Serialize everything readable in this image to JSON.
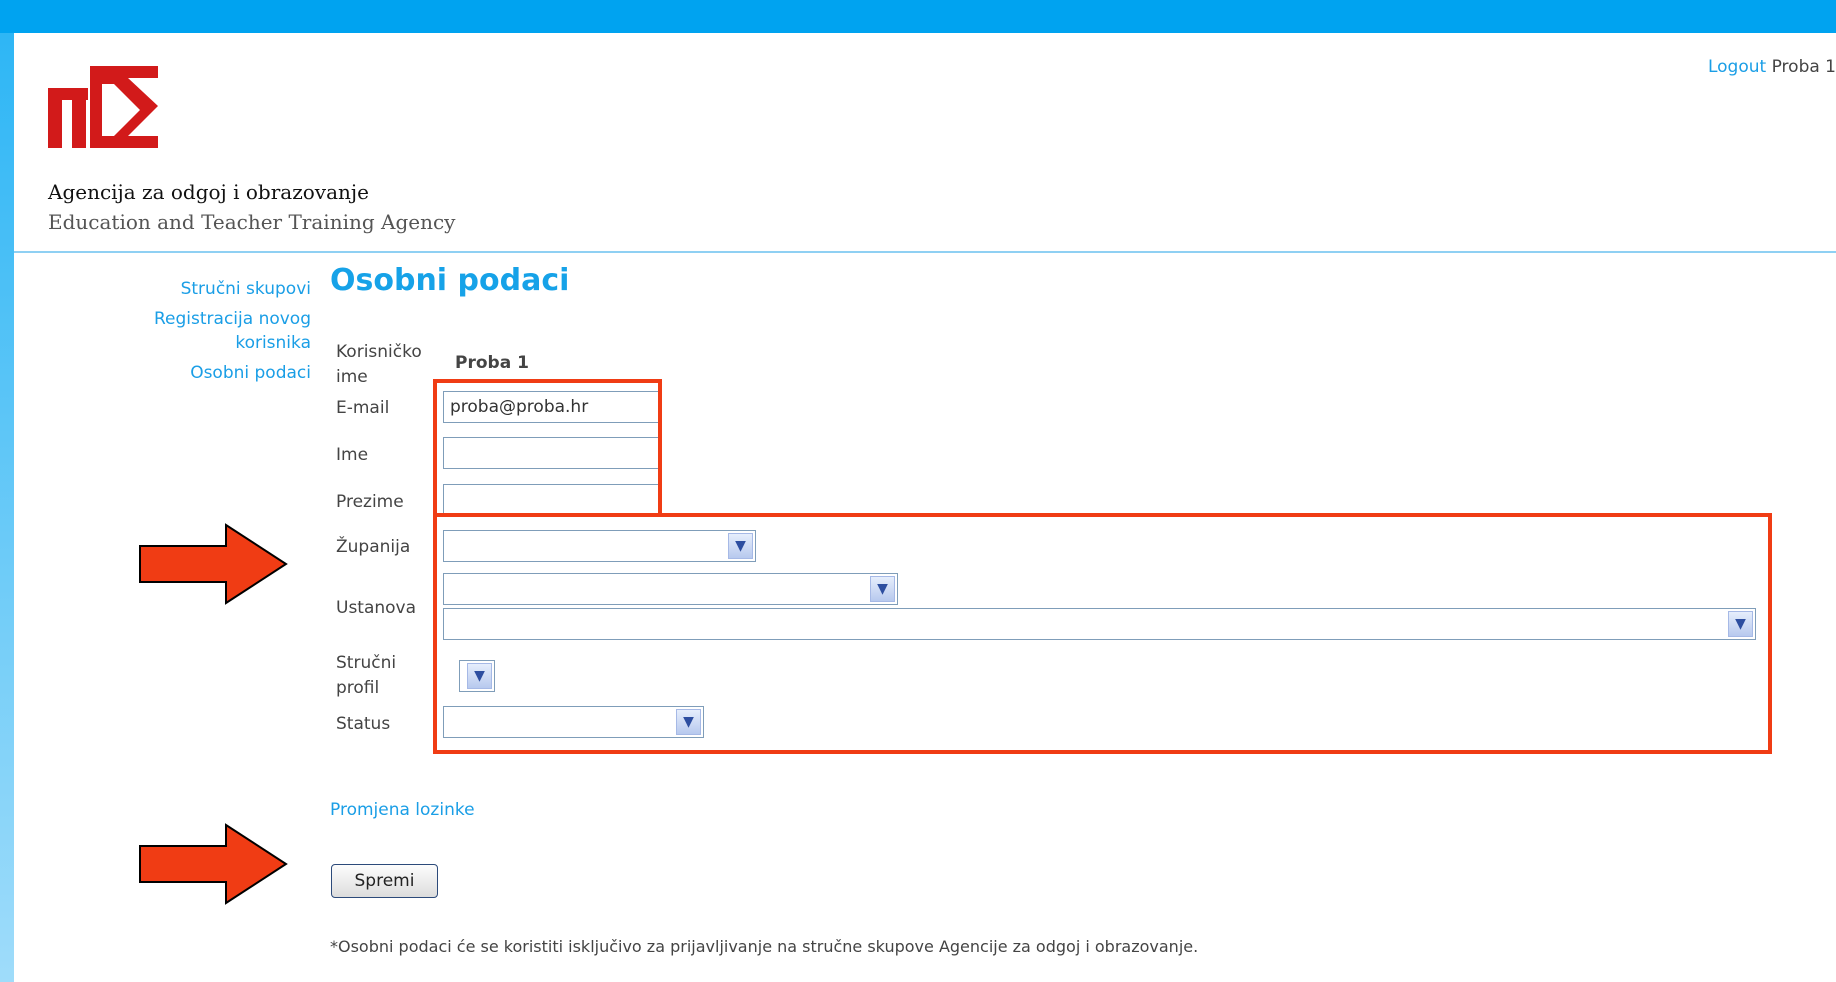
{
  "header": {
    "logout_label": "Logout",
    "user_name": "Proba 1",
    "agency_name_hr": "Agencija za odgoj i obrazovanje",
    "agency_name_en": "Education and Teacher Training Agency"
  },
  "sidebar": {
    "items": [
      {
        "label": "Stručni skupovi"
      },
      {
        "label": "Registracija novog korisnika"
      },
      {
        "label": "Osobni podaci"
      }
    ]
  },
  "page": {
    "title": "Osobni podaci",
    "fields": {
      "username_label": "Korisničko ime",
      "username_value": "Proba 1",
      "email_label": "E-mail",
      "email_value": "proba@proba.hr",
      "ime_label": "Ime",
      "ime_value": "",
      "prezime_label": "Prezime",
      "prezime_value": "",
      "zupanija_label": "Županija",
      "ustanova_label": "Ustanova",
      "strucni_profil_label": "Stručni profil",
      "status_label": "Status"
    },
    "change_password_link": "Promjena lozinke",
    "save_button": "Spremi",
    "footnote": "*Osobni podaci će se koristiti isključivo za prijavljivanje na stručne skupove Agencije za odgoj i obrazovanje."
  },
  "colors": {
    "accent": "#00a3f0",
    "link": "#1a9ee6",
    "highlight": "#f03c14"
  }
}
